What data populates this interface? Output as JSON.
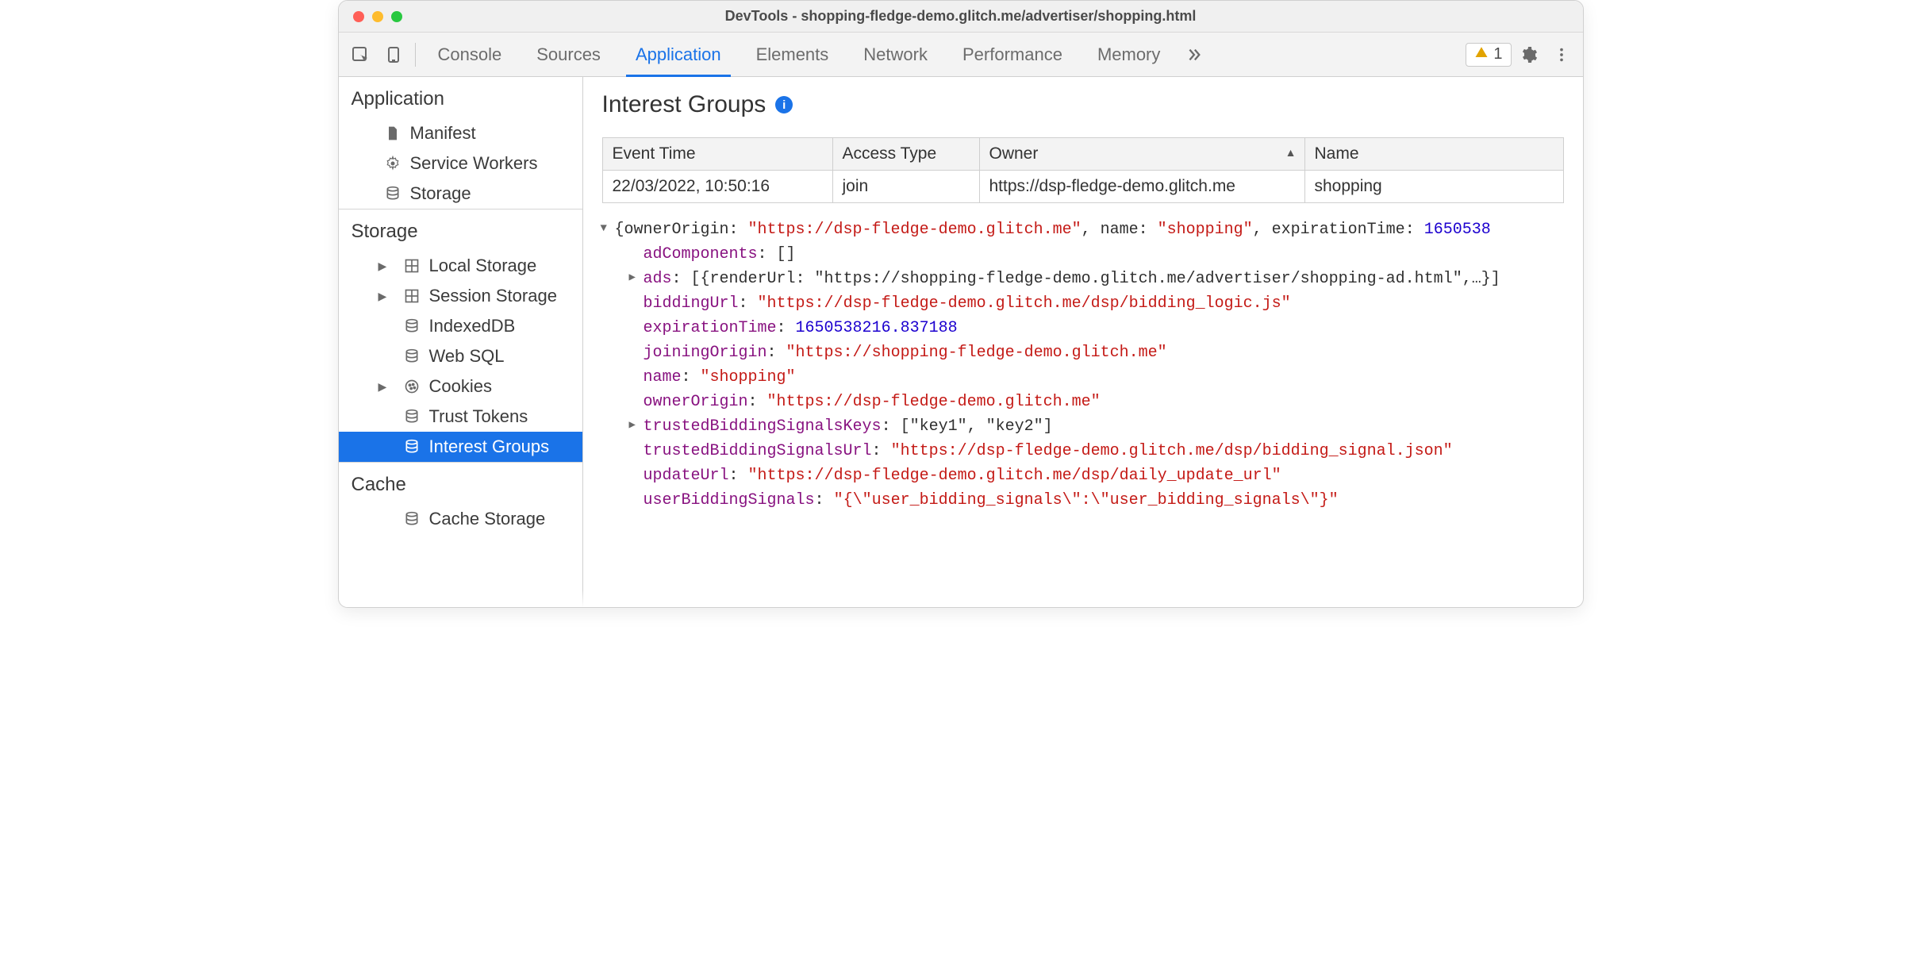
{
  "window": {
    "title": "DevTools - shopping-fledge-demo.glitch.me/advertiser/shopping.html"
  },
  "toolbar": {
    "tabs": [
      "Console",
      "Sources",
      "Application",
      "Elements",
      "Network",
      "Performance",
      "Memory"
    ],
    "active_tab_index": 2,
    "warning_count": "1"
  },
  "sidebar": {
    "sections": [
      {
        "title": "Application",
        "items": [
          {
            "label": "Manifest",
            "icon": "file-icon"
          },
          {
            "label": "Service Workers",
            "icon": "gear-icon"
          },
          {
            "label": "Storage",
            "icon": "database-icon"
          }
        ]
      },
      {
        "title": "Storage",
        "items": [
          {
            "label": "Local Storage",
            "icon": "grid-icon",
            "expandable": true
          },
          {
            "label": "Session Storage",
            "icon": "grid-icon",
            "expandable": true
          },
          {
            "label": "IndexedDB",
            "icon": "database-icon"
          },
          {
            "label": "Web SQL",
            "icon": "database-icon"
          },
          {
            "label": "Cookies",
            "icon": "cookie-icon",
            "expandable": true
          },
          {
            "label": "Trust Tokens",
            "icon": "database-icon"
          },
          {
            "label": "Interest Groups",
            "icon": "database-icon",
            "selected": true
          }
        ]
      },
      {
        "title": "Cache",
        "items": [
          {
            "label": "Cache Storage",
            "icon": "database-icon"
          }
        ]
      }
    ]
  },
  "panel": {
    "heading": "Interest Groups",
    "columns": [
      "Event Time",
      "Access Type",
      "Owner",
      "Name"
    ],
    "sorted_column_index": 2,
    "rows": [
      {
        "event_time": "22/03/2022, 10:50:16",
        "access_type": "join",
        "owner": "https://dsp-fledge-demo.glitch.me",
        "name": "shopping"
      }
    ]
  },
  "details": {
    "top_line_prefix": "{ownerOrigin: ",
    "top_ownerOrigin": "\"https://dsp-fledge-demo.glitch.me\"",
    "top_mid1": ", name: ",
    "top_name": "\"shopping\"",
    "top_mid2": ", expirationTime: ",
    "top_expiration_trunc": "1650538",
    "adComponents_key": "adComponents",
    "adComponents_val": "[]",
    "ads_key": "ads",
    "ads_val": "[{renderUrl: \"https://shopping-fledge-demo.glitch.me/advertiser/shopping-ad.html\",…}]",
    "biddingUrl_key": "biddingUrl",
    "biddingUrl_val": "\"https://dsp-fledge-demo.glitch.me/dsp/bidding_logic.js\"",
    "expirationTime_key": "expirationTime",
    "expirationTime_val": "1650538216.837188",
    "joiningOrigin_key": "joiningOrigin",
    "joiningOrigin_val": "\"https://shopping-fledge-demo.glitch.me\"",
    "name_key": "name",
    "name_val": "\"shopping\"",
    "ownerOrigin_key": "ownerOrigin",
    "ownerOrigin_val": "\"https://dsp-fledge-demo.glitch.me\"",
    "tbsk_key": "trustedBiddingSignalsKeys",
    "tbsk_val": "[\"key1\", \"key2\"]",
    "tbsu_key": "trustedBiddingSignalsUrl",
    "tbsu_val": "\"https://dsp-fledge-demo.glitch.me/dsp/bidding_signal.json\"",
    "updateUrl_key": "updateUrl",
    "updateUrl_val": "\"https://dsp-fledge-demo.glitch.me/dsp/daily_update_url\"",
    "ubs_key": "userBiddingSignals",
    "ubs_val": "\"{\\\"user_bidding_signals\\\":\\\"user_bidding_signals\\\"}\""
  }
}
